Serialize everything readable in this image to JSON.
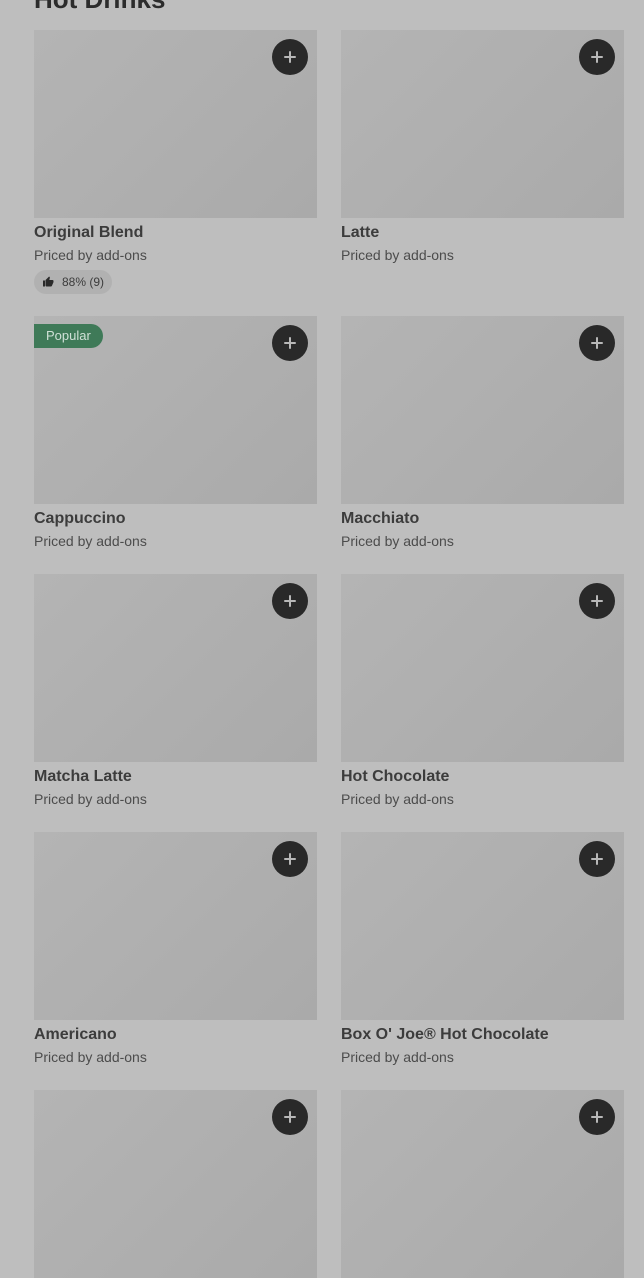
{
  "section": {
    "title": "Hot Drinks"
  },
  "items": [
    {
      "name": "Original Blend",
      "price": "Priced by add-ons",
      "rating": "88% (9)",
      "badge": ""
    },
    {
      "name": "Latte",
      "price": "Priced by add-ons",
      "rating": "",
      "badge": ""
    },
    {
      "name": "Cappuccino",
      "price": "Priced by add-ons",
      "rating": "",
      "badge": "Popular"
    },
    {
      "name": "Macchiato",
      "price": "Priced by add-ons",
      "rating": "",
      "badge": ""
    },
    {
      "name": "Matcha Latte",
      "price": "Priced by add-ons",
      "rating": "",
      "badge": ""
    },
    {
      "name": "Hot Chocolate",
      "price": "Priced by add-ons",
      "rating": "",
      "badge": ""
    },
    {
      "name": "Americano",
      "price": "Priced by add-ons",
      "rating": "",
      "badge": ""
    },
    {
      "name": "Box O' Joe® Hot Chocolate",
      "price": "Priced by add-ons",
      "rating": "",
      "badge": ""
    },
    {
      "name": "",
      "price": "",
      "rating": "",
      "badge": ""
    },
    {
      "name": "",
      "price": "",
      "rating": "",
      "badge": ""
    }
  ],
  "icons": {
    "add": "plus-icon",
    "rating": "thumbs-up-icon"
  },
  "colors": {
    "background": "#bebebe",
    "add_button": "#292929",
    "badge": "#3f7a58"
  }
}
